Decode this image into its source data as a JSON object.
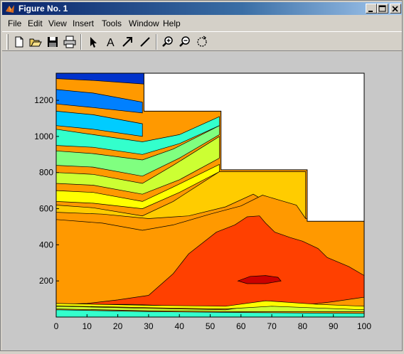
{
  "window": {
    "title": "Figure No. 1"
  },
  "menu": {
    "items": [
      "File",
      "Edit",
      "View",
      "Insert",
      "Tools",
      "Window",
      "Help"
    ]
  },
  "toolbar": {
    "tools": [
      "new-file-icon",
      "open-folder-icon",
      "save-icon",
      "print-icon",
      "select-arrow-icon",
      "insert-text-icon",
      "insert-arrow-icon",
      "insert-line-icon",
      "zoom-in-icon",
      "zoom-out-icon",
      "rotate-3d-icon"
    ]
  },
  "chart_data": {
    "type": "contour",
    "title": "",
    "xlabel": "",
    "ylabel": "",
    "xlim": [
      0,
      100
    ],
    "ylim": [
      0,
      1350
    ],
    "x_ticks": [
      0,
      10,
      20,
      30,
      40,
      50,
      60,
      70,
      80,
      90,
      100
    ],
    "y_ticks": [
      200,
      400,
      600,
      800,
      1000,
      1200
    ],
    "grid": false,
    "colormap": "jet",
    "boundary": [
      [
        0,
        1350
      ],
      [
        28.5,
        1350
      ],
      [
        28.5,
        1140
      ],
      [
        53.5,
        1140
      ],
      [
        53.5,
        815
      ],
      [
        81.5,
        815
      ],
      [
        81.5,
        530
      ],
      [
        100,
        530
      ],
      [
        100,
        0
      ],
      [
        0,
        0
      ]
    ],
    "filled_levels": [
      {
        "color": "#ff4000",
        "polygon": [
          [
            0,
            70
          ],
          [
            10,
            75
          ],
          [
            20,
            95
          ],
          [
            30,
            120
          ],
          [
            38,
            240
          ],
          [
            43,
            350
          ],
          [
            52,
            470
          ],
          [
            58,
            510
          ],
          [
            62,
            555
          ],
          [
            66,
            560
          ],
          [
            68,
            520
          ],
          [
            71,
            470
          ],
          [
            76,
            440
          ],
          [
            80,
            420
          ],
          [
            85,
            380
          ],
          [
            88,
            330
          ],
          [
            95,
            280
          ],
          [
            100,
            230
          ],
          [
            100,
            110
          ],
          [
            90,
            85
          ],
          [
            80,
            65
          ],
          [
            70,
            60
          ],
          [
            55,
            55
          ],
          [
            40,
            60
          ],
          [
            25,
            70
          ]
        ]
      },
      {
        "color": "#cc0000",
        "polygon": [
          [
            59,
            200
          ],
          [
            63,
            225
          ],
          [
            68,
            230
          ],
          [
            72,
            220
          ],
          [
            73,
            200
          ],
          [
            68,
            185
          ],
          [
            62,
            185
          ]
        ]
      },
      {
        "color": "#ff9900",
        "polygon": [
          [
            0,
            540
          ],
          [
            15,
            520
          ],
          [
            28,
            480
          ],
          [
            38,
            510
          ],
          [
            50,
            570
          ],
          [
            60,
            615
          ],
          [
            67,
            675
          ],
          [
            72,
            650
          ],
          [
            78,
            620
          ],
          [
            81,
            545
          ],
          [
            100,
            530
          ],
          [
            100,
            0
          ],
          [
            0,
            0
          ]
        ]
      },
      {
        "color": "#ffcc00",
        "polygon": [
          [
            0,
            620
          ],
          [
            12,
            605
          ],
          [
            28,
            560
          ],
          [
            38,
            640
          ],
          [
            53,
            805
          ],
          [
            81,
            805
          ],
          [
            81,
            530
          ],
          [
            72,
            600
          ],
          [
            64,
            680
          ],
          [
            55,
            610
          ],
          [
            43,
            560
          ],
          [
            30,
            545
          ],
          [
            15,
            570
          ],
          [
            0,
            580
          ]
        ]
      },
      {
        "color": "#ffff00",
        "polygon": [
          [
            0,
            700
          ],
          [
            12,
            690
          ],
          [
            28,
            640
          ],
          [
            38,
            720
          ],
          [
            53,
            845
          ],
          [
            53,
            805
          ],
          [
            40,
            690
          ],
          [
            28,
            600
          ],
          [
            12,
            630
          ],
          [
            0,
            640
          ]
        ]
      },
      {
        "color": "#ccff33",
        "polygon": [
          [
            0,
            800
          ],
          [
            12,
            790
          ],
          [
            28,
            740
          ],
          [
            38,
            840
          ],
          [
            53,
            1000
          ],
          [
            53,
            880
          ],
          [
            40,
            760
          ],
          [
            28,
            680
          ],
          [
            12,
            730
          ],
          [
            0,
            740
          ]
        ]
      },
      {
        "color": "#80ff80",
        "polygon": [
          [
            0,
            920
          ],
          [
            12,
            905
          ],
          [
            28,
            870
          ],
          [
            38,
            930
          ],
          [
            53,
            1060
          ],
          [
            53,
            1010
          ],
          [
            40,
            880
          ],
          [
            28,
            780
          ],
          [
            12,
            830
          ],
          [
            0,
            840
          ]
        ]
      },
      {
        "color": "#33ffcc",
        "polygon": [
          [
            0,
            1040
          ],
          [
            12,
            1010
          ],
          [
            28,
            970
          ],
          [
            40,
            1010
          ],
          [
            53,
            1110
          ],
          [
            53,
            1060
          ],
          [
            40,
            960
          ],
          [
            28,
            900
          ],
          [
            12,
            940
          ],
          [
            0,
            950
          ]
        ]
      },
      {
        "color": "#00ccff",
        "polygon": [
          [
            0,
            1140
          ],
          [
            12,
            1120
          ],
          [
            28,
            1070
          ],
          [
            28,
            1000
          ],
          [
            12,
            1040
          ],
          [
            0,
            1060
          ]
        ]
      },
      {
        "color": "#0080ff",
        "polygon": [
          [
            0,
            1260
          ],
          [
            12,
            1240
          ],
          [
            28,
            1190
          ],
          [
            28,
            1130
          ],
          [
            12,
            1160
          ],
          [
            0,
            1180
          ]
        ]
      },
      {
        "color": "#0033cc",
        "polygon": [
          [
            0,
            1350
          ],
          [
            28.5,
            1350
          ],
          [
            28.5,
            1290
          ],
          [
            12,
            1310
          ],
          [
            0,
            1320
          ]
        ]
      }
    ]
  }
}
